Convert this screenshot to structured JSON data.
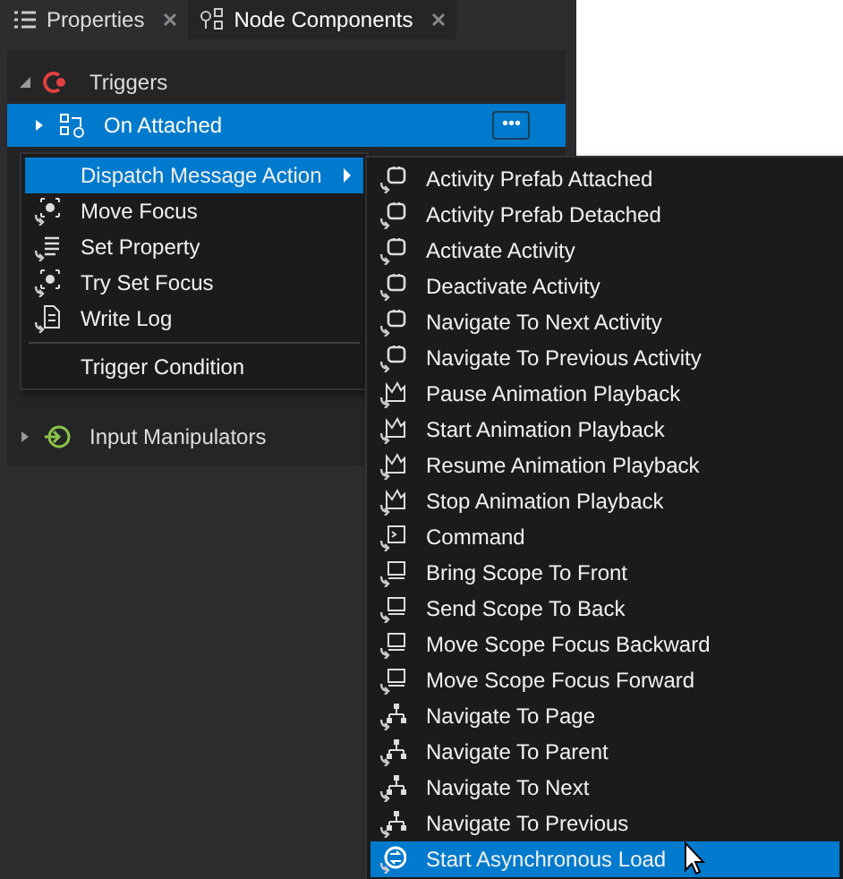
{
  "tabs": [
    {
      "label": "Properties",
      "selected": false,
      "kind": "list"
    },
    {
      "label": "Node Components",
      "selected": true,
      "kind": "nodes"
    }
  ],
  "tree": [
    {
      "label": "Triggers",
      "expanded": true,
      "selected": false,
      "kind": "trigger",
      "children": [
        {
          "label": "On Attached",
          "expanded": false,
          "selected": true,
          "kind": "attached",
          "more_button": "•••"
        }
      ]
    },
    {
      "label": "Input Manipulators",
      "expanded": false,
      "selected": false,
      "kind": "input"
    }
  ],
  "context_menu": {
    "items": [
      {
        "label": "Dispatch Message Action",
        "kind": "submenu",
        "selected": true
      },
      {
        "label": "Move Focus",
        "kind": "focus",
        "selected": false
      },
      {
        "label": "Set Property",
        "kind": "property",
        "selected": false
      },
      {
        "label": "Try Set Focus",
        "kind": "focus",
        "selected": false
      },
      {
        "label": "Write Log",
        "kind": "log",
        "selected": false
      },
      {
        "label": "Trigger Condition",
        "kind": "separated",
        "selected": false
      }
    ]
  },
  "submenu": {
    "items": [
      {
        "label": "Activity Prefab Attached",
        "kind": "message",
        "selected": false
      },
      {
        "label": "Activity Prefab Detached",
        "kind": "message",
        "selected": false
      },
      {
        "label": "Activate Activity",
        "kind": "message",
        "selected": false
      },
      {
        "label": "Deactivate Activity",
        "kind": "message",
        "selected": false
      },
      {
        "label": "Navigate To Next Activity",
        "kind": "message",
        "selected": false
      },
      {
        "label": "Navigate To Previous Activity",
        "kind": "message",
        "selected": false
      },
      {
        "label": "Pause Animation Playback",
        "kind": "animation",
        "selected": false
      },
      {
        "label": "Start Animation Playback",
        "kind": "animation",
        "selected": false
      },
      {
        "label": "Resume Animation Playback",
        "kind": "animation",
        "selected": false
      },
      {
        "label": "Stop Animation Playback",
        "kind": "animation",
        "selected": false
      },
      {
        "label": "Command",
        "kind": "command",
        "selected": false
      },
      {
        "label": "Bring Scope To Front",
        "kind": "scope",
        "selected": false
      },
      {
        "label": "Send Scope To Back",
        "kind": "scope",
        "selected": false
      },
      {
        "label": "Move Scope Focus Backward",
        "kind": "scope",
        "selected": false
      },
      {
        "label": "Move Scope Focus Forward",
        "kind": "scope",
        "selected": false
      },
      {
        "label": "Navigate To Page",
        "kind": "navigate",
        "selected": false
      },
      {
        "label": "Navigate To Parent",
        "kind": "navigate",
        "selected": false
      },
      {
        "label": "Navigate To Next",
        "kind": "navigate",
        "selected": false
      },
      {
        "label": "Navigate To Previous",
        "kind": "navigate",
        "selected": false
      },
      {
        "label": "Start Asynchronous Load",
        "kind": "async",
        "selected": true
      }
    ]
  }
}
